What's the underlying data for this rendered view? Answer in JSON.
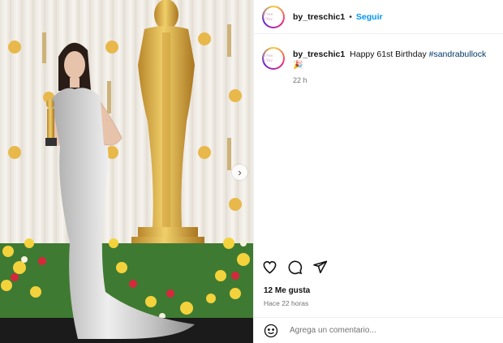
{
  "post": {
    "username": "by_treschic1",
    "follow_label": "Seguir",
    "avatar_text": "Tres Chic",
    "next_icon": "chevron-right-icon"
  },
  "caption": {
    "username": "by_treschic1",
    "text": "Happy 61st Birthday",
    "hashtag": "#sandrabullock",
    "emoji": "🎉",
    "time": "22 h"
  },
  "actions": {
    "icons": [
      "heart-icon",
      "comment-icon",
      "share-icon"
    ]
  },
  "stats": {
    "likes": "12 Me gusta",
    "ago": "Hace 22 horas"
  },
  "comment": {
    "placeholder": "Agrega un comentario...",
    "emoji_icon": "smiley-icon"
  },
  "colors": {
    "follow_blue": "#0095f6",
    "hashtag": "#00376b",
    "gold": "#d4a437"
  }
}
